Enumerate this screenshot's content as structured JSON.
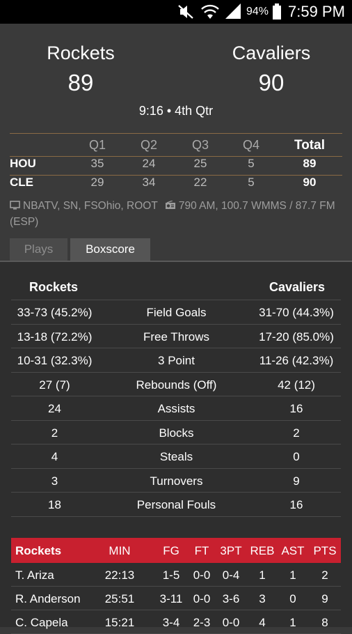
{
  "status_bar": {
    "icons": [
      "mute-icon",
      "wifi-icon",
      "signal-icon",
      "battery-icon"
    ],
    "battery_pct": "94%",
    "time": "7:59 PM"
  },
  "game": {
    "home_team": "Rockets",
    "home_score": "89",
    "away_team": "Cavaliers",
    "away_score": "90",
    "clock": "9:16 • 4th Qtr"
  },
  "linescore": {
    "headers": [
      "Q1",
      "Q2",
      "Q3",
      "Q4",
      "Total"
    ],
    "rows": [
      {
        "team": "HOU",
        "q": [
          "35",
          "24",
          "25",
          "5"
        ],
        "total": "89"
      },
      {
        "team": "CLE",
        "q": [
          "29",
          "34",
          "22",
          "5"
        ],
        "total": "90"
      }
    ]
  },
  "broadcast": {
    "tv": "NBATV, SN, FSOhio, ROOT",
    "radio": "790 AM, 100.7 WMMS / 87.7 FM (ESP)"
  },
  "tabs": [
    {
      "label": "Plays",
      "selected": false
    },
    {
      "label": "Boxscore",
      "selected": true
    }
  ],
  "team_stats": {
    "home_label": "Rockets",
    "away_label": "Cavaliers",
    "rows": [
      {
        "home": "33-73 (45.2%)",
        "label": "Field Goals",
        "away": "31-70 (44.3%)"
      },
      {
        "home": "13-18 (72.2%)",
        "label": "Free Throws",
        "away": "17-20 (85.0%)"
      },
      {
        "home": "10-31 (32.3%)",
        "label": "3 Point",
        "away": "11-26 (42.3%)"
      },
      {
        "home": "27 (7)",
        "label": "Rebounds (Off)",
        "away": "42 (12)"
      },
      {
        "home": "24",
        "label": "Assists",
        "away": "16"
      },
      {
        "home": "2",
        "label": "Blocks",
        "away": "2"
      },
      {
        "home": "4",
        "label": "Steals",
        "away": "0"
      },
      {
        "home": "3",
        "label": "Turnovers",
        "away": "9"
      },
      {
        "home": "18",
        "label": "Personal Fouls",
        "away": "16"
      }
    ]
  },
  "player_table": {
    "team": "Rockets",
    "header_color": "#c8202f",
    "columns": [
      "MIN",
      "FG",
      "FT",
      "3PT",
      "REB",
      "AST",
      "PTS"
    ],
    "players": [
      {
        "name": "T. Ariza",
        "min": "22:13",
        "fg": "1-5",
        "ft": "0-0",
        "tpt": "0-4",
        "reb": "1",
        "ast": "1",
        "pts": "2"
      },
      {
        "name": "R. Anderson",
        "min": "25:51",
        "fg": "3-11",
        "ft": "0-0",
        "tpt": "3-6",
        "reb": "3",
        "ast": "0",
        "pts": "9"
      },
      {
        "name": "C. Capela",
        "min": "15:21",
        "fg": "3-4",
        "ft": "2-3",
        "tpt": "0-0",
        "reb": "4",
        "ast": "1",
        "pts": "8"
      }
    ]
  }
}
